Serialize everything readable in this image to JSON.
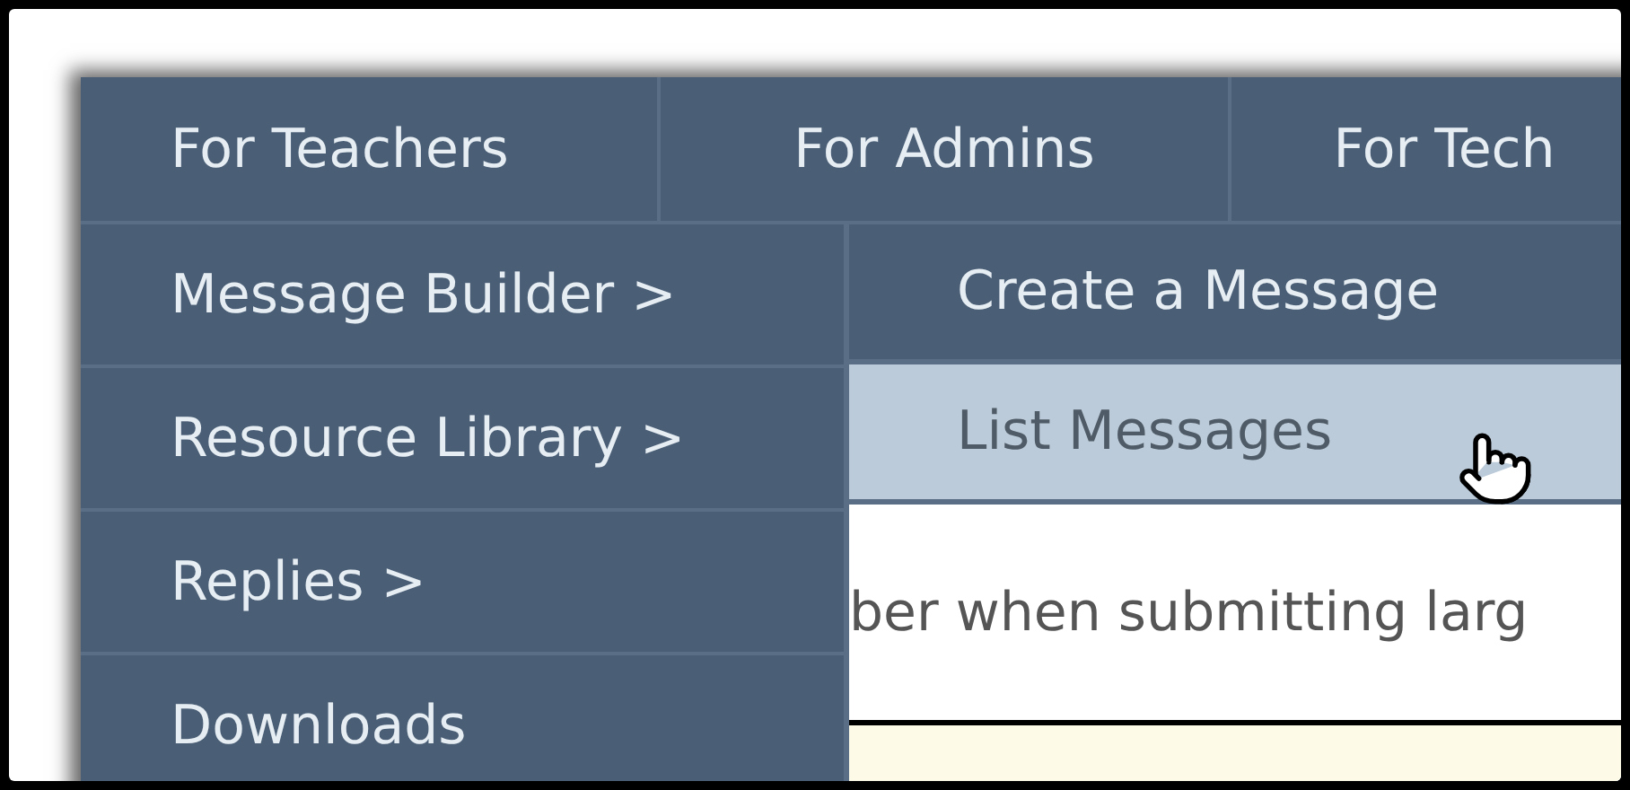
{
  "top_menu": [
    {
      "label": "For Teachers"
    },
    {
      "label": "For Admins"
    },
    {
      "label": "For Tech"
    }
  ],
  "dropdown": [
    {
      "label": "Message Builder >"
    },
    {
      "label": "Resource Library >"
    },
    {
      "label": "Replies >"
    },
    {
      "label": "Downloads"
    }
  ],
  "submenu": [
    {
      "label": "Create a Message",
      "selected": false
    },
    {
      "label": "List Messages",
      "selected": true
    }
  ],
  "page_text": "ber when submitting larg"
}
